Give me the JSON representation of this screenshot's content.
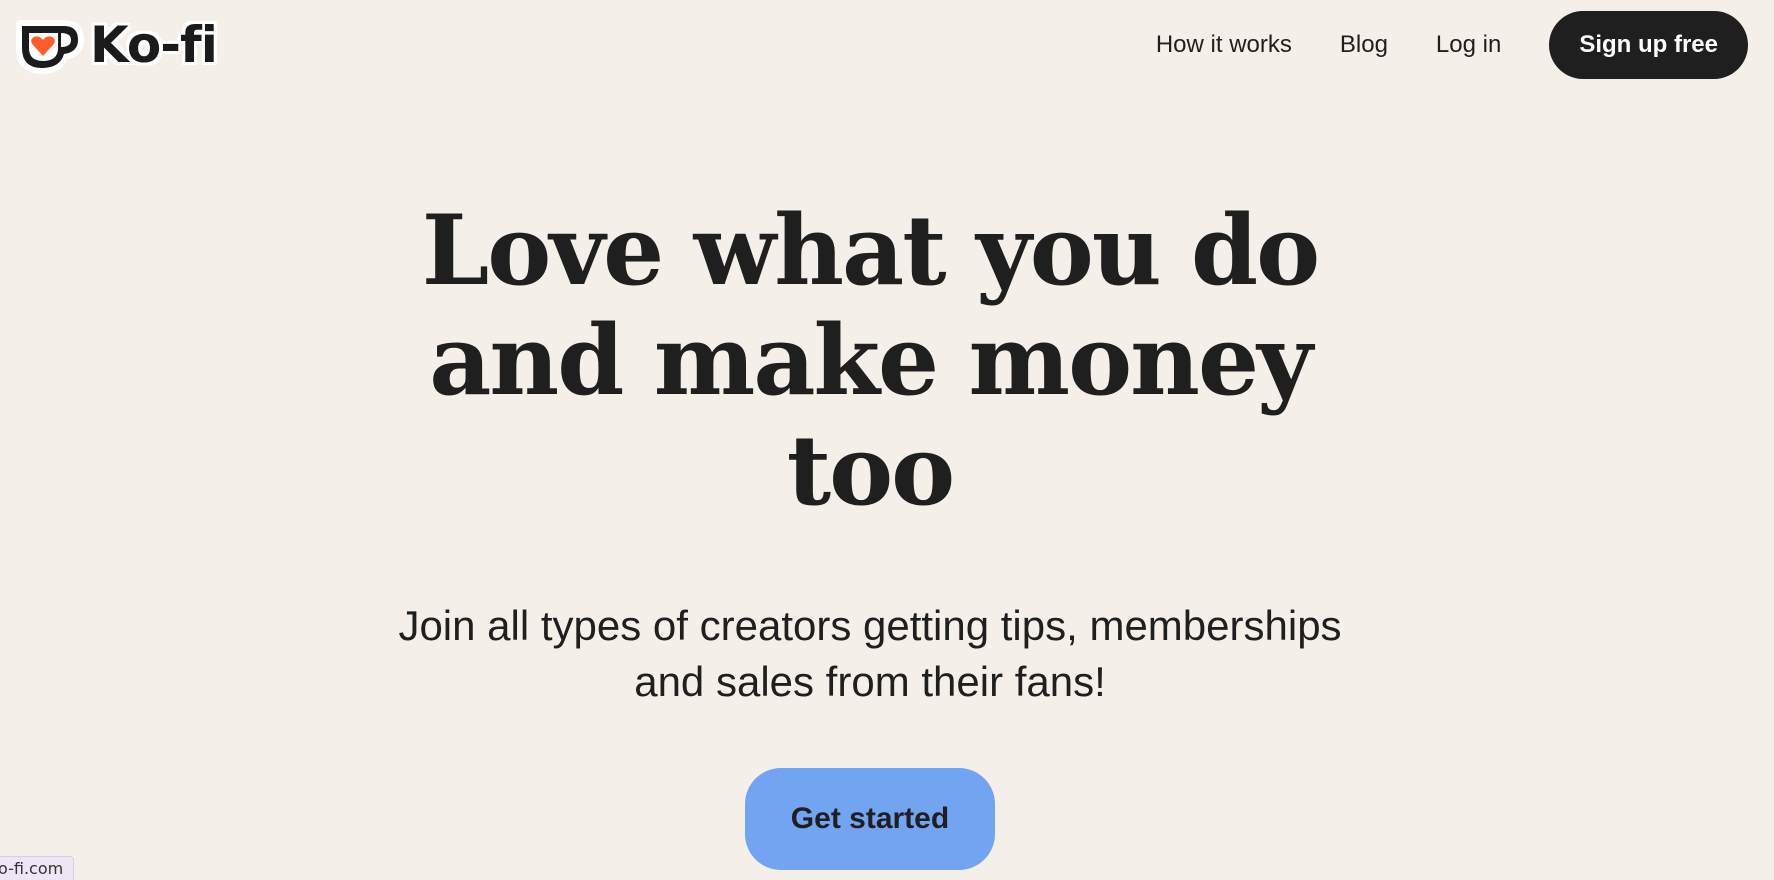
{
  "header": {
    "logo_text": "Ko-fi",
    "nav": {
      "how_it_works": "How it works",
      "blog": "Blog",
      "log_in": "Log in",
      "sign_up": "Sign up free"
    }
  },
  "hero": {
    "title_line1": "Love what you do",
    "title_line2": "and make money",
    "title_line3": "too",
    "subtitle_line1": "Join all types of creators getting tips, memberships",
    "subtitle_line2": "and sales from their fans!",
    "cta_label": "Get started"
  },
  "status_bar": {
    "url": "o-fi.com"
  },
  "colors": {
    "background": "#F4EFE8",
    "text": "#1F1F1F",
    "signup_button": "#1F1F1F",
    "cta_button": "#72A4F2",
    "logo_heart": "#FF5E2B"
  },
  "icons": {
    "logo": "coffee-cup-heart-icon"
  }
}
